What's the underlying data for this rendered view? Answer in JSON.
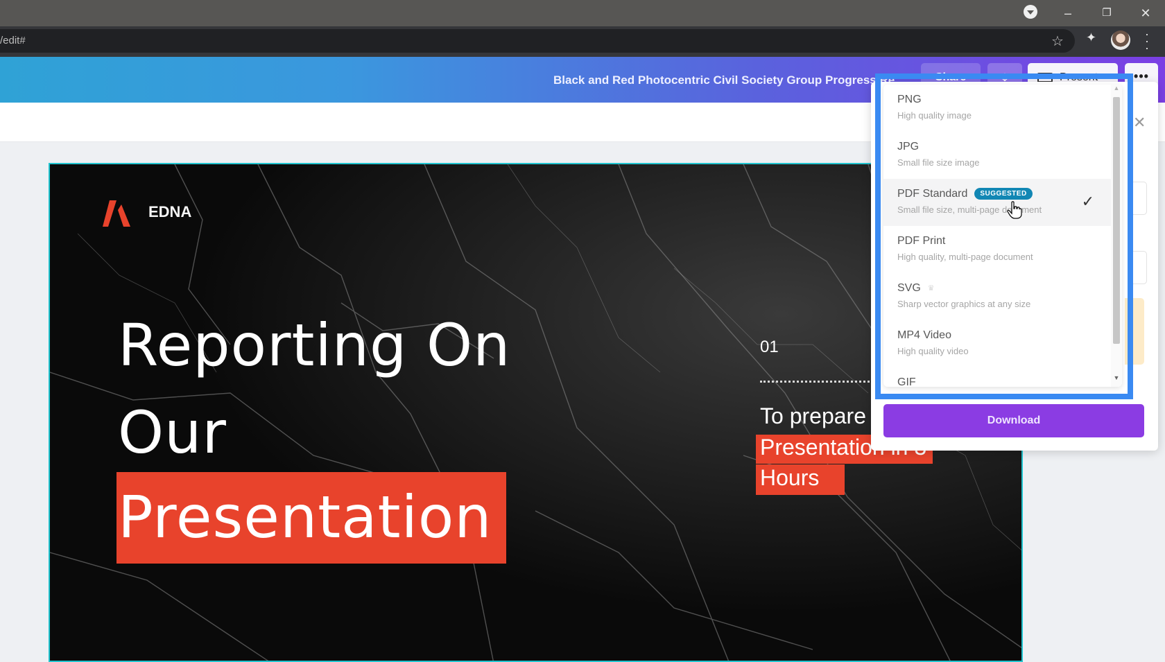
{
  "browser": {
    "url_fragment": "/edit#",
    "window_controls": {
      "minimize": "–",
      "restore": "❐",
      "close": "✕"
    },
    "icons": [
      "media-control-icon",
      "star-icon",
      "extensions-icon",
      "profile-avatar",
      "kebab-menu-icon"
    ]
  },
  "header": {
    "document_title": "Black and Red Photocentric Civil Society Group Progress Re...",
    "share_label": "Share",
    "download_icon": "⤓",
    "present_label": "Present",
    "more_label": "•••",
    "colors": {
      "gradient_start": "#2fa2d6",
      "gradient_end": "#7b3fe4"
    }
  },
  "slide": {
    "brand_name": "EDNA",
    "title_line1": "Reporting On",
    "title_line2": "Our",
    "title_line3": "Presentation",
    "number": "01",
    "subtitle_line1": "To prepare a",
    "subtitle_line2": "Presentation in 3",
    "subtitle_line3": "Hours",
    "accent_color": "#e8432c",
    "selection_color": "#20c4cf"
  },
  "download_panel": {
    "close_icon": "✕",
    "file_type_options": [
      {
        "name": "PNG",
        "description": "High quality image"
      },
      {
        "name": "JPG",
        "description": "Small file size image"
      },
      {
        "name": "PDF Standard",
        "description": "Small file size, multi-page document",
        "badge": "SUGGESTED",
        "selected": true
      },
      {
        "name": "PDF Print",
        "description": "High quality, multi-page document"
      },
      {
        "name": "SVG",
        "description": "Sharp vector graphics at any size",
        "premium": true
      },
      {
        "name": "MP4 Video",
        "description": "High quality video"
      },
      {
        "name": "GIF",
        "description": ""
      }
    ],
    "check_icon": "✓",
    "crown_icon": "♛",
    "download_label": "Download",
    "button_color": "#8b3ce3",
    "highlight_color": "#3a8af2"
  }
}
